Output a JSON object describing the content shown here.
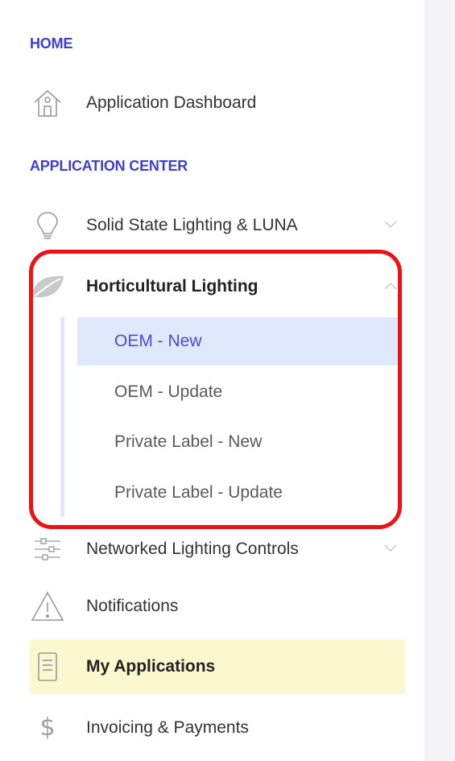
{
  "sidebar": {
    "home_section": "HOME",
    "dashboard_label": "Application Dashboard",
    "app_center_section": "APPLICATION CENTER",
    "ssl_label": "Solid State Lighting & LUNA",
    "horticultural_label": "Horticultural Lighting",
    "sub_items": [
      "OEM - New",
      "OEM - Update",
      "Private Label - New",
      "Private Label - Update"
    ],
    "nlc_label": "Networked Lighting Controls",
    "notifications_label": "Notifications",
    "my_apps_label": "My Applications",
    "invoicing_label": "Invoicing & Payments"
  },
  "colors": {
    "accent": "#3f3fd1",
    "active_bg": "#dfe9fb",
    "selected_bg": "#fbf7cf",
    "highlight": "#ee1111"
  },
  "icons": {
    "dashboard": "house-icon",
    "ssl": "lightbulb-icon",
    "horticultural": "leaf-icon",
    "nlc": "sliders-icon",
    "notifications": "warning-icon",
    "my_apps": "document-icon",
    "invoicing": "dollar-icon"
  }
}
